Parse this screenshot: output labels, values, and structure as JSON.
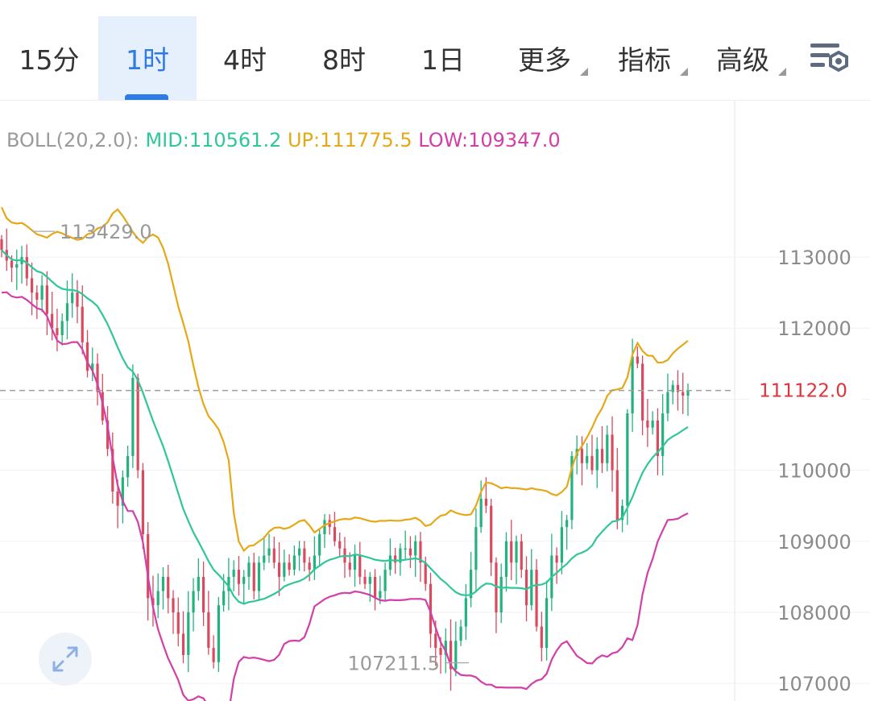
{
  "tabs": [
    {
      "label": "15分",
      "active": false
    },
    {
      "label": "1时",
      "active": true
    },
    {
      "label": "4时",
      "active": false
    },
    {
      "label": "8时",
      "active": false
    },
    {
      "label": "1日",
      "active": false
    },
    {
      "label": "更多",
      "active": false,
      "dropdown": true
    },
    {
      "label": "指标",
      "active": false,
      "dropdown": true
    },
    {
      "label": "高级",
      "active": false,
      "dropdown": true
    }
  ],
  "legend": {
    "label": "BOLL(20,2.0):",
    "mid": "MID:110561.2",
    "up": "UP:111775.5",
    "low": "LOW:109347.0"
  },
  "colors": {
    "up_candle": "#23b27e",
    "down_candle": "#d94a5f",
    "mid_line": "#2fc79a",
    "upper_band": "#e6a817",
    "lower_band": "#d23fa8",
    "current_price": "#e0323c",
    "active_tab": "#2e7be6"
  },
  "chart_data": {
    "type": "candlestick",
    "y_axis": {
      "ticks": [
        107000,
        108000,
        109000,
        110000,
        111000,
        112000,
        113000
      ],
      "tick_labels": [
        "107000",
        "108000",
        "109000",
        "110000",
        "",
        "112000",
        "113000"
      ],
      "range": [
        106900,
        114200
      ]
    },
    "current_price": {
      "value": 111122.0,
      "label": "111122.0"
    },
    "annotations": [
      {
        "label": "113429.0",
        "value": 113429.0,
        "kind": "high"
      },
      {
        "label": "107211.5",
        "value": 107211.5,
        "kind": "low"
      }
    ],
    "close": [
      113100,
      112950,
      112850,
      112900,
      113000,
      112700,
      112500,
      112400,
      112600,
      112200,
      112000,
      111900,
      112100,
      112350,
      112500,
      112300,
      111800,
      111400,
      111500,
      111100,
      110700,
      110300,
      109700,
      109500,
      109900,
      110200,
      111300,
      110000,
      109100,
      108200,
      108100,
      108300,
      108500,
      108200,
      108000,
      107700,
      107400,
      108000,
      108300,
      108500,
      108000,
      107500,
      107300,
      108100,
      108300,
      108500,
      108600,
      108400,
      108500,
      108700,
      108300,
      108700,
      108800,
      108900,
      108700,
      108500,
      108700,
      108600,
      108800,
      108900,
      108700,
      108600,
      108800,
      109100,
      109300,
      109200,
      109000,
      108900,
      108700,
      108600,
      108800,
      108500,
      108400,
      108500,
      108200,
      108300,
      108600,
      108800,
      108700,
      108900,
      108900,
      108800,
      109000,
      108700,
      108400,
      107700,
      107500,
      107400,
      107600,
      107200,
      107600,
      107800,
      108200,
      108600,
      109200,
      109600,
      109500,
      108700,
      108000,
      108500,
      109000,
      108700,
      109000,
      108600,
      108100,
      108600,
      107800,
      107500,
      108200,
      108800,
      108700,
      109200,
      109300,
      110200,
      110300,
      110100,
      110200,
      110000,
      110300,
      110100,
      110500,
      110000,
      109300,
      109500,
      110800,
      111600,
      111500,
      110700,
      110600,
      110700,
      110200,
      110800,
      111100,
      111200,
      111100,
      111050,
      111122
    ]
  }
}
